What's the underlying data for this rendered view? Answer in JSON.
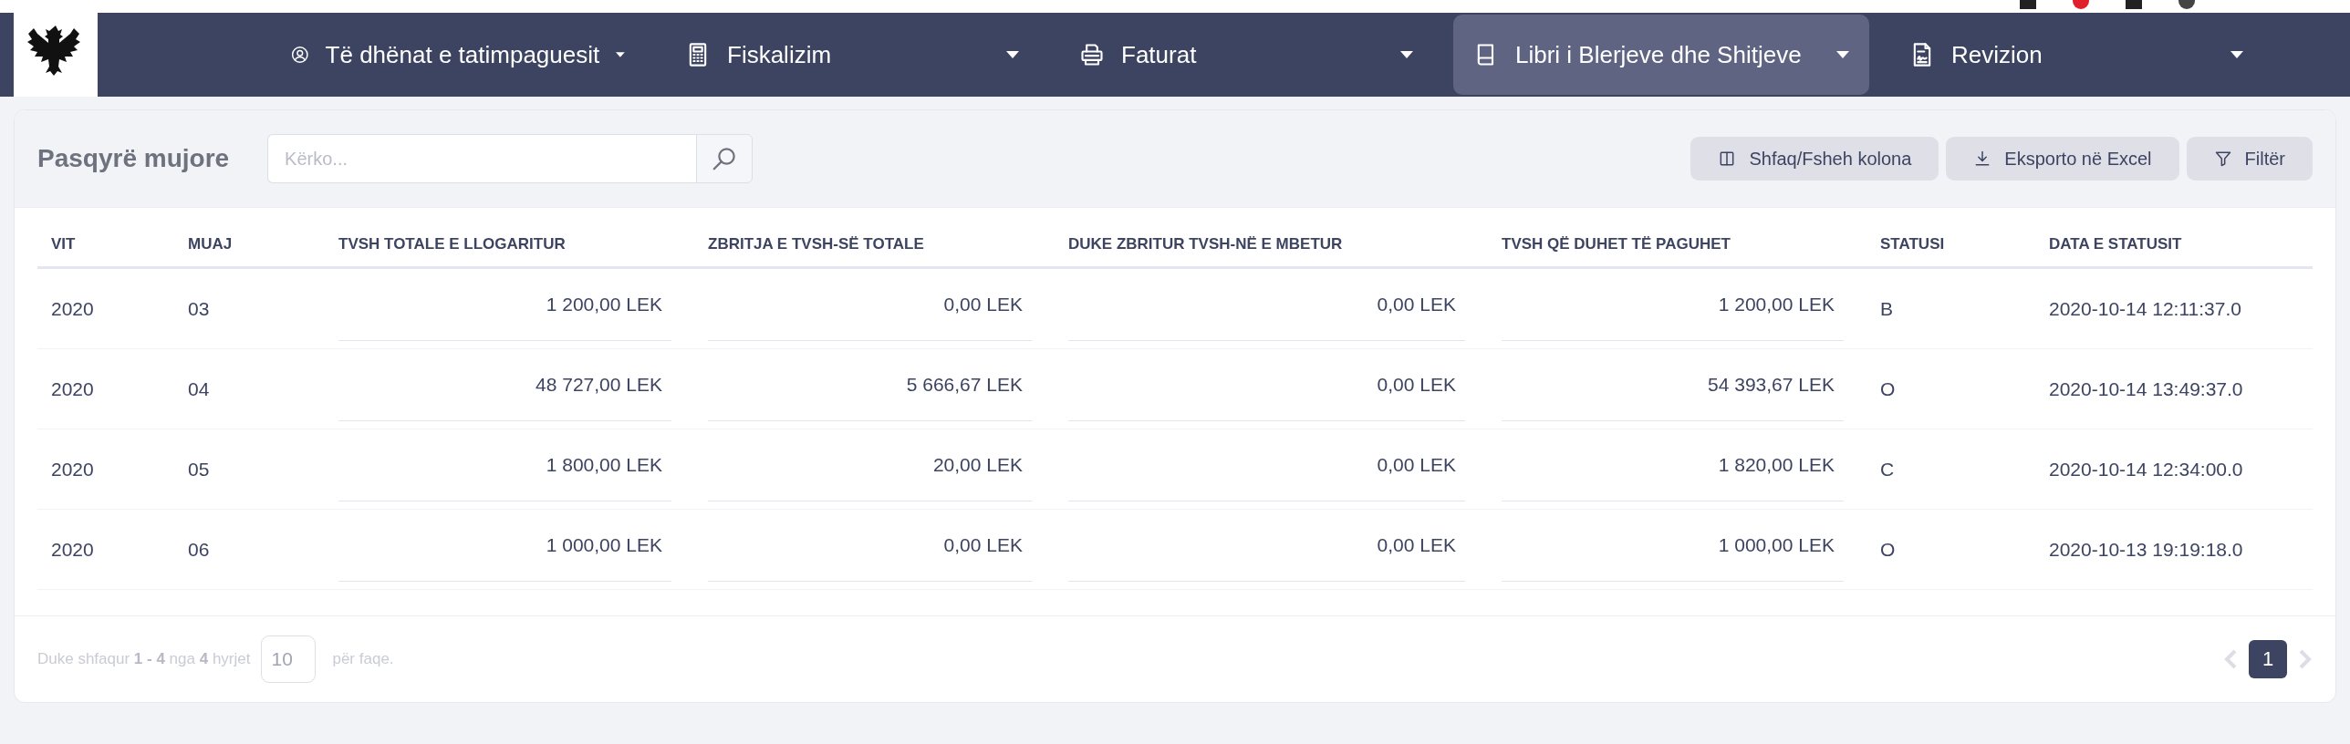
{
  "nav": {
    "items": [
      {
        "label": "Të dhënat e tatimpaguesit",
        "selected": false
      },
      {
        "label": "Fiskalizim",
        "selected": false
      },
      {
        "label": "Faturat",
        "selected": false
      },
      {
        "label": "Libri i Blerjeve dhe Shitjeve",
        "selected": true
      },
      {
        "label": "Revizion",
        "selected": false
      }
    ]
  },
  "panel": {
    "title": "Pasqyrë mujore",
    "search": {
      "placeholder": "Kërko..."
    },
    "buttons": [
      {
        "label": "Shfaq/Fsheh kolona"
      },
      {
        "label": "Eksporto në Excel"
      },
      {
        "label": "Filtër"
      }
    ]
  },
  "table": {
    "columns": [
      {
        "label": "VIT",
        "kind": "text"
      },
      {
        "label": "MUAJ",
        "kind": "text"
      },
      {
        "label": "TVSH TOTALE E LLOGARITUR",
        "kind": "amount"
      },
      {
        "label": "ZBRITJA E TVSH-SË TOTALE",
        "kind": "amount"
      },
      {
        "label": "DUKE ZBRITUR TVSH-NË E MBETUR",
        "kind": "amount"
      },
      {
        "label": "TVSH QË DUHET TË PAGUHET",
        "kind": "amount"
      },
      {
        "label": "STATUSI",
        "kind": "text"
      },
      {
        "label": "DATA E STATUSIT",
        "kind": "text"
      }
    ],
    "rows": [
      [
        "2020",
        "03",
        "1 200,00 LEK",
        "0,00 LEK",
        "0,00 LEK",
        "1 200,00 LEK",
        "B",
        "2020-10-14 12:11:37.0"
      ],
      [
        "2020",
        "04",
        "48 727,00 LEK",
        "5 666,67 LEK",
        "0,00 LEK",
        "54 393,67 LEK",
        "O",
        "2020-10-14 13:49:37.0"
      ],
      [
        "2020",
        "05",
        "1 800,00 LEK",
        "20,00 LEK",
        "0,00 LEK",
        "1 820,00 LEK",
        "C",
        "2020-10-14 12:34:00.0"
      ],
      [
        "2020",
        "06",
        "1 000,00 LEK",
        "0,00 LEK",
        "0,00 LEK",
        "1 000,00 LEK",
        "O",
        "2020-10-13 19:19:18.0"
      ]
    ]
  },
  "footer": {
    "summary": "Duke shfaqur **1 - 4** nga **4** hyrjet",
    "page_size": "10",
    "page_size_suffix": "për faqe.",
    "pages": [
      {
        "label": "1",
        "selected": true
      }
    ]
  }
}
